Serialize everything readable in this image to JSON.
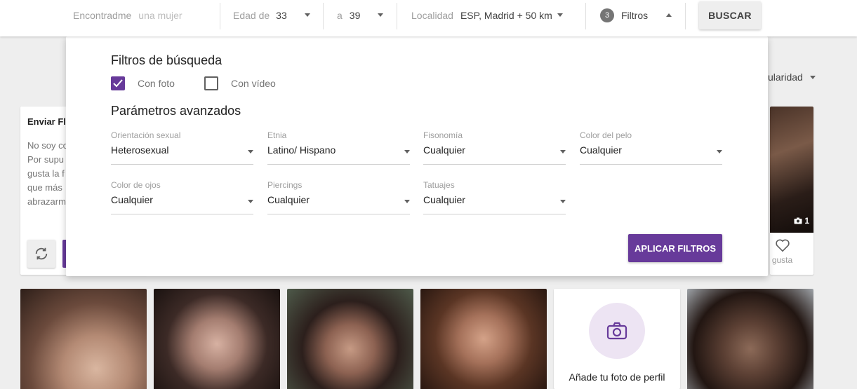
{
  "search": {
    "find_label": "Encontradme",
    "find_value": "una mujer",
    "age_from_label": "Edad de",
    "age_from_value": "33",
    "age_to_label": "a",
    "age_to_value": "39",
    "location_label": "Localidad",
    "location_value": "ESP, Madrid + 50 km",
    "filters_count": "3",
    "filters_label": "Filtros",
    "search_button": "BUSCAR"
  },
  "sort": {
    "label": "ularidad"
  },
  "send_card": {
    "title": "Enviar Fli",
    "lines": [
      "No soy co",
      "Por supu",
      "gusta la f",
      "que más",
      "abrazarm"
    ]
  },
  "profile_card": {
    "photo_count": "1",
    "like_label": "Me gusta"
  },
  "add_photo": {
    "label": "Añade tu foto de perfil"
  },
  "filters_panel": {
    "title": "Filtros de búsqueda",
    "checkboxes": [
      {
        "label": "Con foto",
        "checked": true
      },
      {
        "label": "Con vídeo",
        "checked": false
      }
    ],
    "advanced_title": "Parámetros avanzados",
    "fields": [
      {
        "label": "Orientación sexual",
        "value": "Heterosexual"
      },
      {
        "label": "Etnia",
        "value": "Latino/ Hispano"
      },
      {
        "label": "Fisonomía",
        "value": "Cualquier"
      },
      {
        "label": "Color del pelo",
        "value": "Cualquier"
      },
      {
        "label": "Color de ojos",
        "value": "Cualquier"
      },
      {
        "label": "Piercings",
        "value": "Cualquier"
      },
      {
        "label": "Tatuajes",
        "value": "Cualquier"
      }
    ],
    "apply_button": "APLICAR FILTROS"
  },
  "colors": {
    "accent": "#673a9a",
    "badge": "#757575"
  },
  "icons": [
    "chevron-down-icon",
    "chevron-up-icon",
    "check-icon",
    "refresh-icon",
    "camera-icon",
    "heart-outline-icon"
  ]
}
